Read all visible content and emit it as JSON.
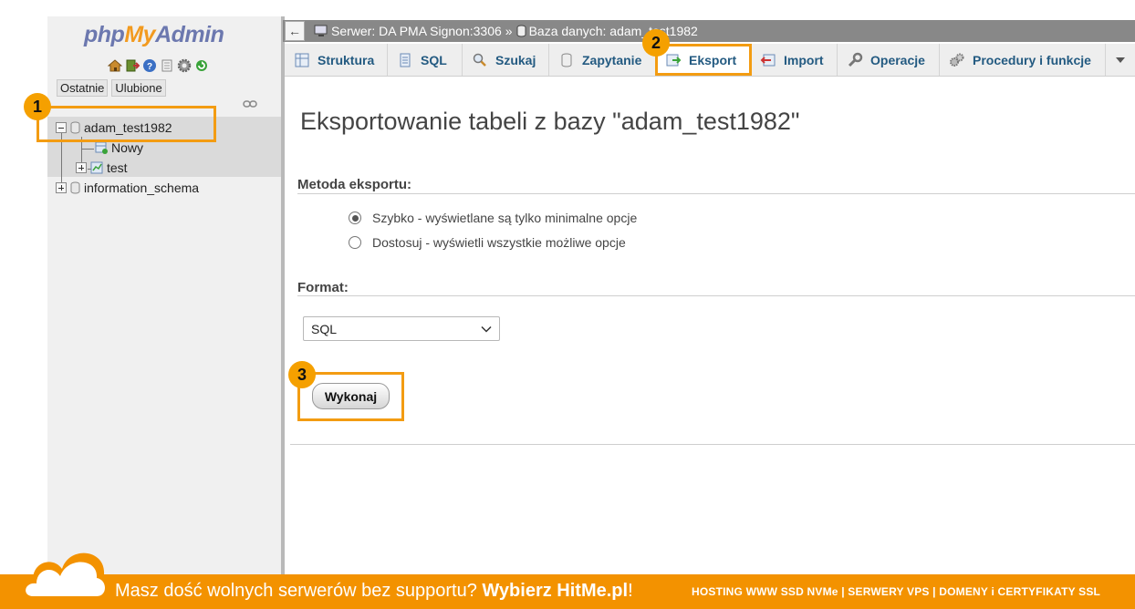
{
  "nav": {
    "logo": {
      "php": "php",
      "my": "My",
      "admin": "Admin"
    },
    "links": [
      "Ostatnie",
      "Ulubione"
    ],
    "tree": {
      "selected_db": "adam_test1982",
      "children": [
        "Nowy",
        "test"
      ],
      "other_db": "information_schema"
    }
  },
  "breadcrumb": {
    "back": "←",
    "server_label": "Serwer: DA PMA Signon:3306",
    "separator": "»",
    "db_label": "Baza danych: adam_test1982"
  },
  "tabs": [
    {
      "label": "Struktura",
      "icon": "structure-icon"
    },
    {
      "label": "SQL",
      "icon": "sql-icon"
    },
    {
      "label": "Szukaj",
      "icon": "search-icon"
    },
    {
      "label": "Zapytanie",
      "icon": "query-icon"
    },
    {
      "label": "Eksport",
      "icon": "export-icon",
      "active": true
    },
    {
      "label": "Import",
      "icon": "import-icon"
    },
    {
      "label": "Operacje",
      "icon": "wrench-icon"
    },
    {
      "label": "Procedury i funkcje",
      "icon": "routines-icon"
    }
  ],
  "main": {
    "title": "Eksportowanie tabeli z bazy \"adam_test1982\"",
    "method_label": "Metoda eksportu:",
    "method_options": [
      {
        "label": "Szybko - wyświetlane są tylko minimalne opcje",
        "checked": true
      },
      {
        "label": "Dostosuj - wyświetli wszystkie możliwe opcje",
        "checked": false
      }
    ],
    "format_label": "Format:",
    "format_value": "SQL",
    "go_label": "Wykonaj"
  },
  "steps": [
    "1",
    "2",
    "3"
  ],
  "banner": {
    "text_lead": "Masz dość wolnych serwerów bez supportu? ",
    "text_strong": "Wybierz HitMe.pl",
    "text_tail": "!",
    "right": "HOSTING WWW SSD NVMe | SERWERY VPS | DOMENY i CERTYFIKATY SSL"
  },
  "colors": {
    "accent": "#f39200",
    "highlight": "#f39c12",
    "tab_text": "#235a81"
  }
}
